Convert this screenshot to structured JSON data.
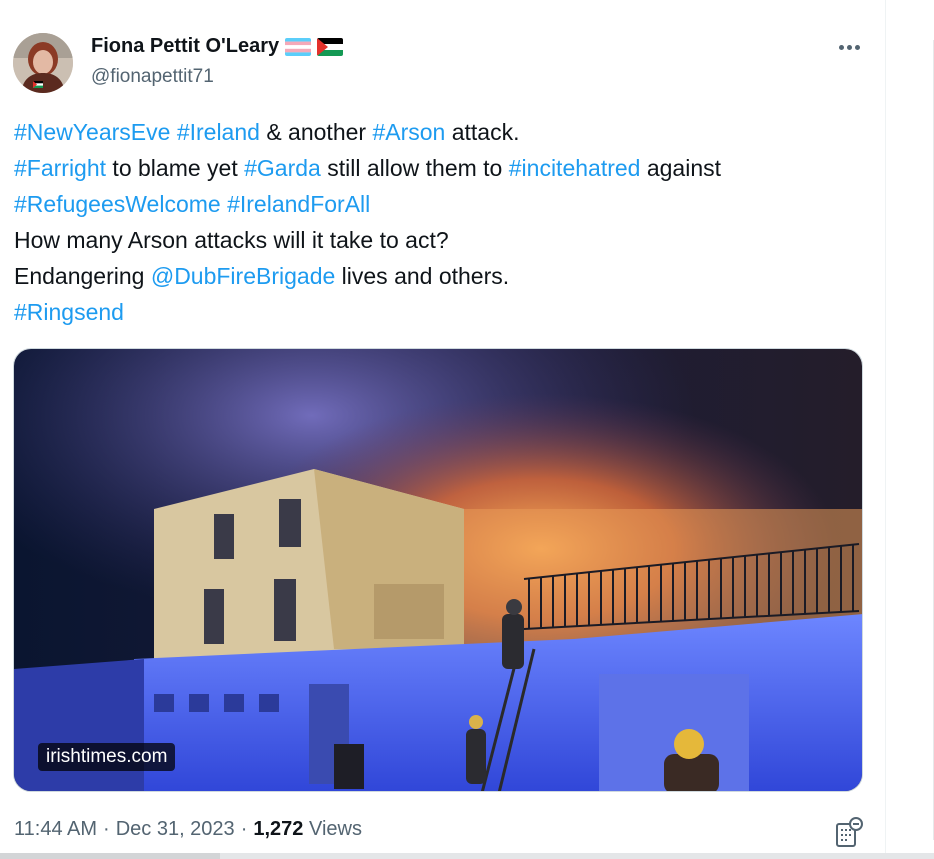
{
  "author": {
    "display_name": "Fiona Pettit O'Leary",
    "handle": "@fionapettit71",
    "flags": [
      "transgender-flag",
      "palestine-flag"
    ]
  },
  "tweet": {
    "lines": [
      [
        {
          "text": "#NewYearsEve",
          "link": true
        },
        {
          "text": " ",
          "link": false
        },
        {
          "text": "#Ireland",
          "link": true
        },
        {
          "text": " & another ",
          "link": false
        },
        {
          "text": "#Arson",
          "link": true
        },
        {
          "text": " attack.",
          "link": false
        }
      ],
      [
        {
          "text": "#Farright",
          "link": true
        },
        {
          "text": " to blame yet ",
          "link": false
        },
        {
          "text": "#Garda",
          "link": true
        },
        {
          "text": " still allow them to ",
          "link": false
        },
        {
          "text": "#incitehatred",
          "link": true
        },
        {
          "text": " against",
          "link": false
        }
      ],
      [
        {
          "text": "#RefugeesWelcome",
          "link": true
        },
        {
          "text": " ",
          "link": false
        },
        {
          "text": "#IrelandForAll",
          "link": true
        }
      ],
      [
        {
          "text": "How many Arson attacks will it take to act?",
          "link": false
        }
      ],
      [
        {
          "text": "Endangering ",
          "link": false
        },
        {
          "text": "@DubFireBrigade",
          "link": true
        },
        {
          "text": " lives and others.",
          "link": false
        }
      ],
      [
        {
          "text": "#Ringsend",
          "link": true
        }
      ]
    ]
  },
  "media": {
    "source_label": "irishtimes.com"
  },
  "meta": {
    "time": "11:44 AM",
    "separator1": "·",
    "date": "Dec 31, 2023",
    "separator2": "·",
    "views_count": "1,272",
    "views_label": "Views"
  },
  "icons": {
    "more": "more-icon",
    "analytics": "analytics-icon"
  },
  "colors": {
    "link": "#1d9bf0",
    "text": "#0f1419",
    "secondary": "#536471"
  }
}
